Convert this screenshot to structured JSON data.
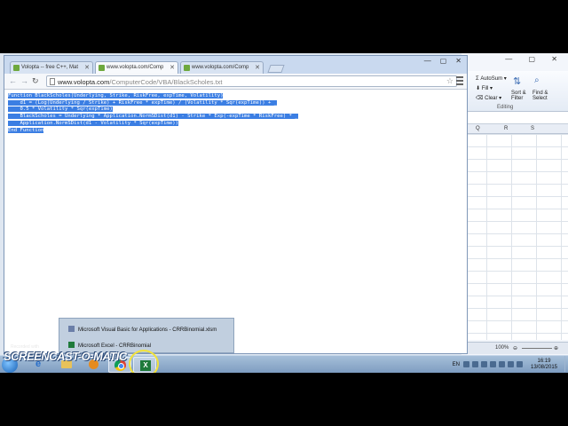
{
  "excel": {
    "ribbon": {
      "autosum": "AutoSum",
      "fill": "Fill",
      "clear": "Clear",
      "sort_filter": "Sort & Filter",
      "find_select": "Find & Select",
      "group_label": "Editing"
    },
    "columns": [
      "Q",
      "R",
      "S"
    ],
    "zoom": "100%"
  },
  "browser": {
    "tabs": [
      {
        "title": "Volopta -- free C++, Mat",
        "active": false
      },
      {
        "title": "www.volopta.com/Comp",
        "active": true
      },
      {
        "title": "www.volopta.com/Comp",
        "active": false
      }
    ],
    "url_host": "www.volopta.com",
    "url_path": "/ComputerCode/VBA/BlackScholes.txt",
    "code_lines": [
      "Function BlackScholes(Underlying, Strike, RiskFree, expTime, Volatility)",
      "    d1 = (Log(Underlying / Strike) + RiskFree * expTime) / (Volatility * Sqr(expTime)) + _",
      "    0.5 * Volatility * Sqr(expTime)",
      "    BlackScholes = Underlying * Application.NormSDist(d1) - Strike * Exp(-expTime * RiskFree) * _",
      "    Application.NormSDist(d1 - Volatility * Sqr(expTime))",
      "End Function"
    ]
  },
  "taskbar": {
    "jump_items": [
      "Microsoft Visual Basic for Applications - CRRBinomial.xlsm",
      "Microsoft Excel - CRRBinomial"
    ],
    "language": "EN",
    "time": "16:19",
    "date": "13/08/2015"
  },
  "watermark": {
    "recorded_with": "Recorded with",
    "brand": "SCREENCAST-O-MATIC"
  }
}
